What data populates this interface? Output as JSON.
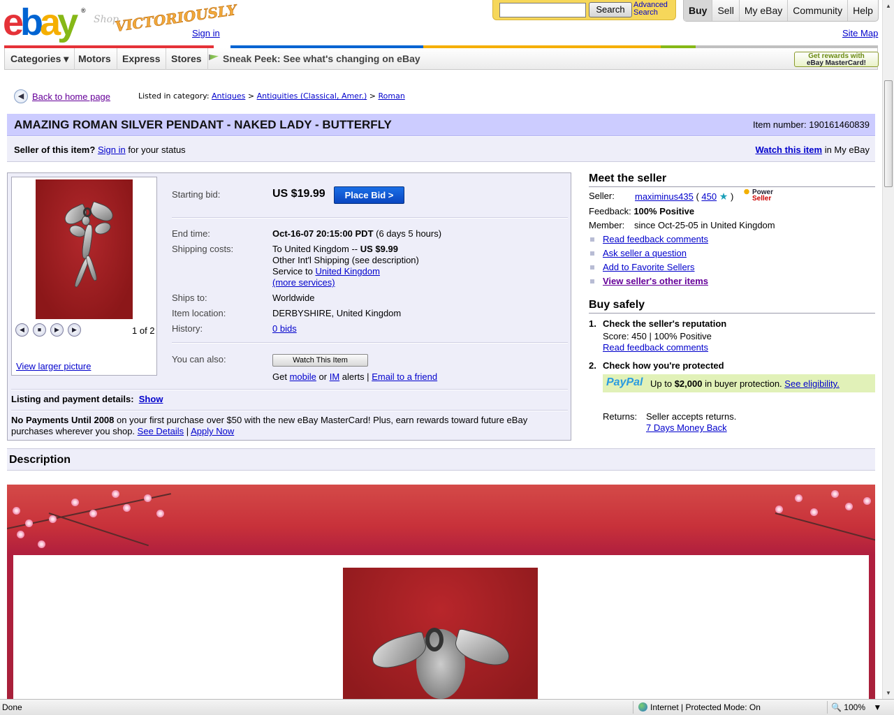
{
  "header": {
    "logo_letters": [
      "e",
      "b",
      "a",
      "y"
    ],
    "logo_reg": "®",
    "promo_shop": "Shop",
    "promo_name": "VICTORIOUSLY",
    "sign_in": "Sign in",
    "search_value": "",
    "search_button": "Search",
    "advanced_search_line1": "Advanced",
    "advanced_search_line2": "Search",
    "top_nav": [
      "Buy",
      "Sell",
      "My eBay",
      "Community",
      "Help"
    ],
    "site_map": "Site Map"
  },
  "colorbar": [
    "#e53238",
    "#ffffff",
    "#0064d2",
    "#f5af02",
    "#86b817",
    "#c0c0c0"
  ],
  "category_nav": {
    "items": [
      "Categories ▾",
      "Motors",
      "Express",
      "Stores"
    ],
    "sneak_peek": "Sneak Peek: See what's changing on eBay",
    "rewards_line1": "Get rewards with",
    "rewards_line2": "eBay MasterCard!"
  },
  "breadcrumb": {
    "back_home": "Back to home page",
    "listed_in": "Listed in category:",
    "crumbs": [
      "Antiques",
      "Antiquities (Classical, Amer.)",
      "Roman"
    ],
    "separator": ">"
  },
  "item": {
    "title": "AMAZING ROMAN SILVER PENDANT - NAKED LADY - BUTTERFLY",
    "item_number_label": "Item number:",
    "item_number": "190161460839",
    "seller_question": "Seller of this item?",
    "seller_signin": "Sign in",
    "seller_status": "for your status",
    "watch_link": "Watch this item",
    "watch_suffix": "in My eBay"
  },
  "picture": {
    "counter": "1 of 2",
    "view_larger": "View larger picture",
    "controls": [
      "prev-icon",
      "stop-icon",
      "play-icon",
      "next-icon"
    ]
  },
  "details": {
    "starting_bid_label": "Starting bid:",
    "starting_bid": "US $19.99",
    "place_bid": "Place Bid >",
    "end_time_label": "End time:",
    "end_time": "Oct-16-07 20:15:00 PDT",
    "end_time_remaining": "(6 days 5 hours)",
    "shipping_label": "Shipping costs:",
    "shipping_line1_a": "To United Kingdom --",
    "shipping_line1_b": "US $9.99",
    "shipping_line2": "Other Int'l Shipping (see description)",
    "shipping_line3_a": "Service to",
    "shipping_line3_b": "United Kingdom",
    "shipping_more": "(more services)",
    "ships_to_label": "Ships to:",
    "ships_to": "Worldwide",
    "location_label": "Item location:",
    "location": "DERBYSHIRE, United Kingdom",
    "history_label": "History:",
    "history": "0 bids",
    "you_can_also": "You can also:",
    "watch_button": "Watch This Item",
    "alerts_get": "Get",
    "alerts_mobile": "mobile",
    "alerts_or": "or",
    "alerts_im": "IM",
    "alerts_suffix": "alerts |",
    "email_friend": "Email to a friend",
    "listing_payment": "Listing and payment details:",
    "show": "Show",
    "nopay_bold": "No Payments Until 2008",
    "nopay_text": "on your first purchase over $50 with the new eBay MasterCard! Plus, earn rewards toward future eBay purchases wherever you shop.",
    "see_details": "See Details",
    "pipe": "|",
    "apply_now": "Apply Now"
  },
  "seller": {
    "heading": "Meet the seller",
    "seller_label": "Seller:",
    "seller_name": "maximinus435",
    "open_paren": "(",
    "feedback_score": "450",
    "close_paren": ")",
    "power_line1": "Power",
    "power_line2": "Seller",
    "feedback_label": "Feedback:",
    "feedback_value": "100% Positive",
    "member_label": "Member:",
    "member_value": "since Oct-25-05 in United Kingdom",
    "links": [
      "Read feedback comments",
      "Ask seller a question",
      "Add to Favorite Sellers",
      "View seller's other items"
    ]
  },
  "buy_safely": {
    "heading": "Buy safely",
    "step1_num": "1.",
    "step1": "Check the seller's reputation",
    "score_line": "Score: 450 | 100% Positive",
    "read_feedback": "Read feedback comments",
    "step2_num": "2.",
    "step2": "Check how you're protected",
    "paypal_a": "Pay",
    "paypal_b": "Pal",
    "protection_a": "Up to",
    "protection_amount": "$2,000",
    "protection_b": "in buyer protection.",
    "eligibility": "See eligibility.",
    "returns_label": "Returns:",
    "returns_value": "Seller accepts returns.",
    "returns_link": "7 Days Money Back"
  },
  "description": {
    "heading": "Description"
  },
  "statusbar": {
    "left": "Done",
    "zone": "Internet | Protected Mode: On",
    "zoom": "100%"
  }
}
